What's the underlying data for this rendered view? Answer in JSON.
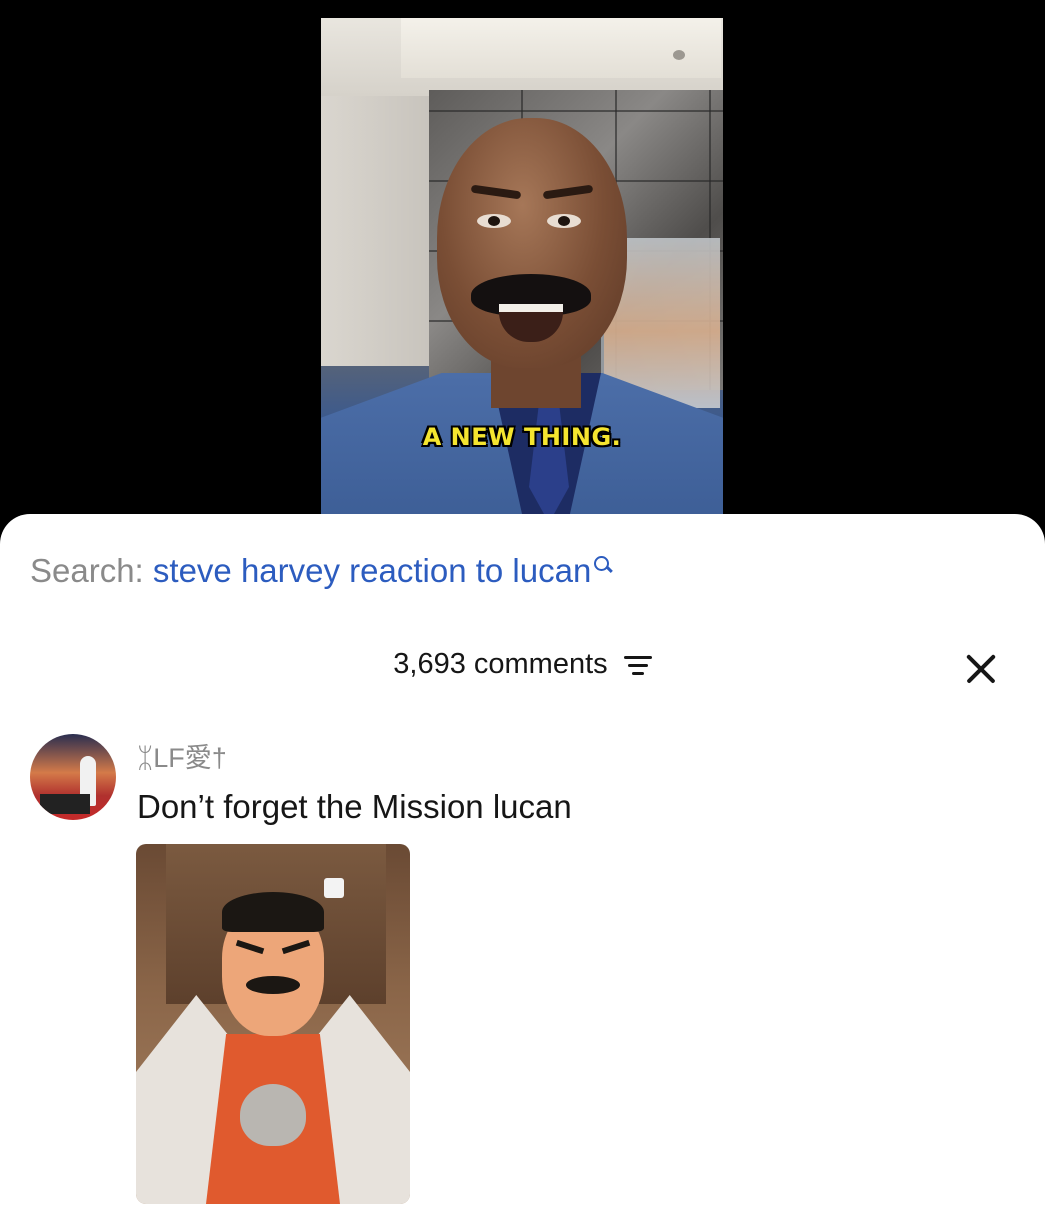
{
  "video": {
    "caption": "A NEW THING."
  },
  "comments_sheet": {
    "search_prefix": "Search:",
    "search_query": "steve harvey reaction to lucan",
    "comment_count_label": "3,693 comments",
    "icons": {
      "search": "search-icon",
      "sort": "sort-filter-icon",
      "close": "close-icon"
    },
    "comments": [
      {
        "username": "ᛯLF愛†",
        "text": "Don’t forget the Mission lucan",
        "has_sticker": true
      }
    ]
  }
}
